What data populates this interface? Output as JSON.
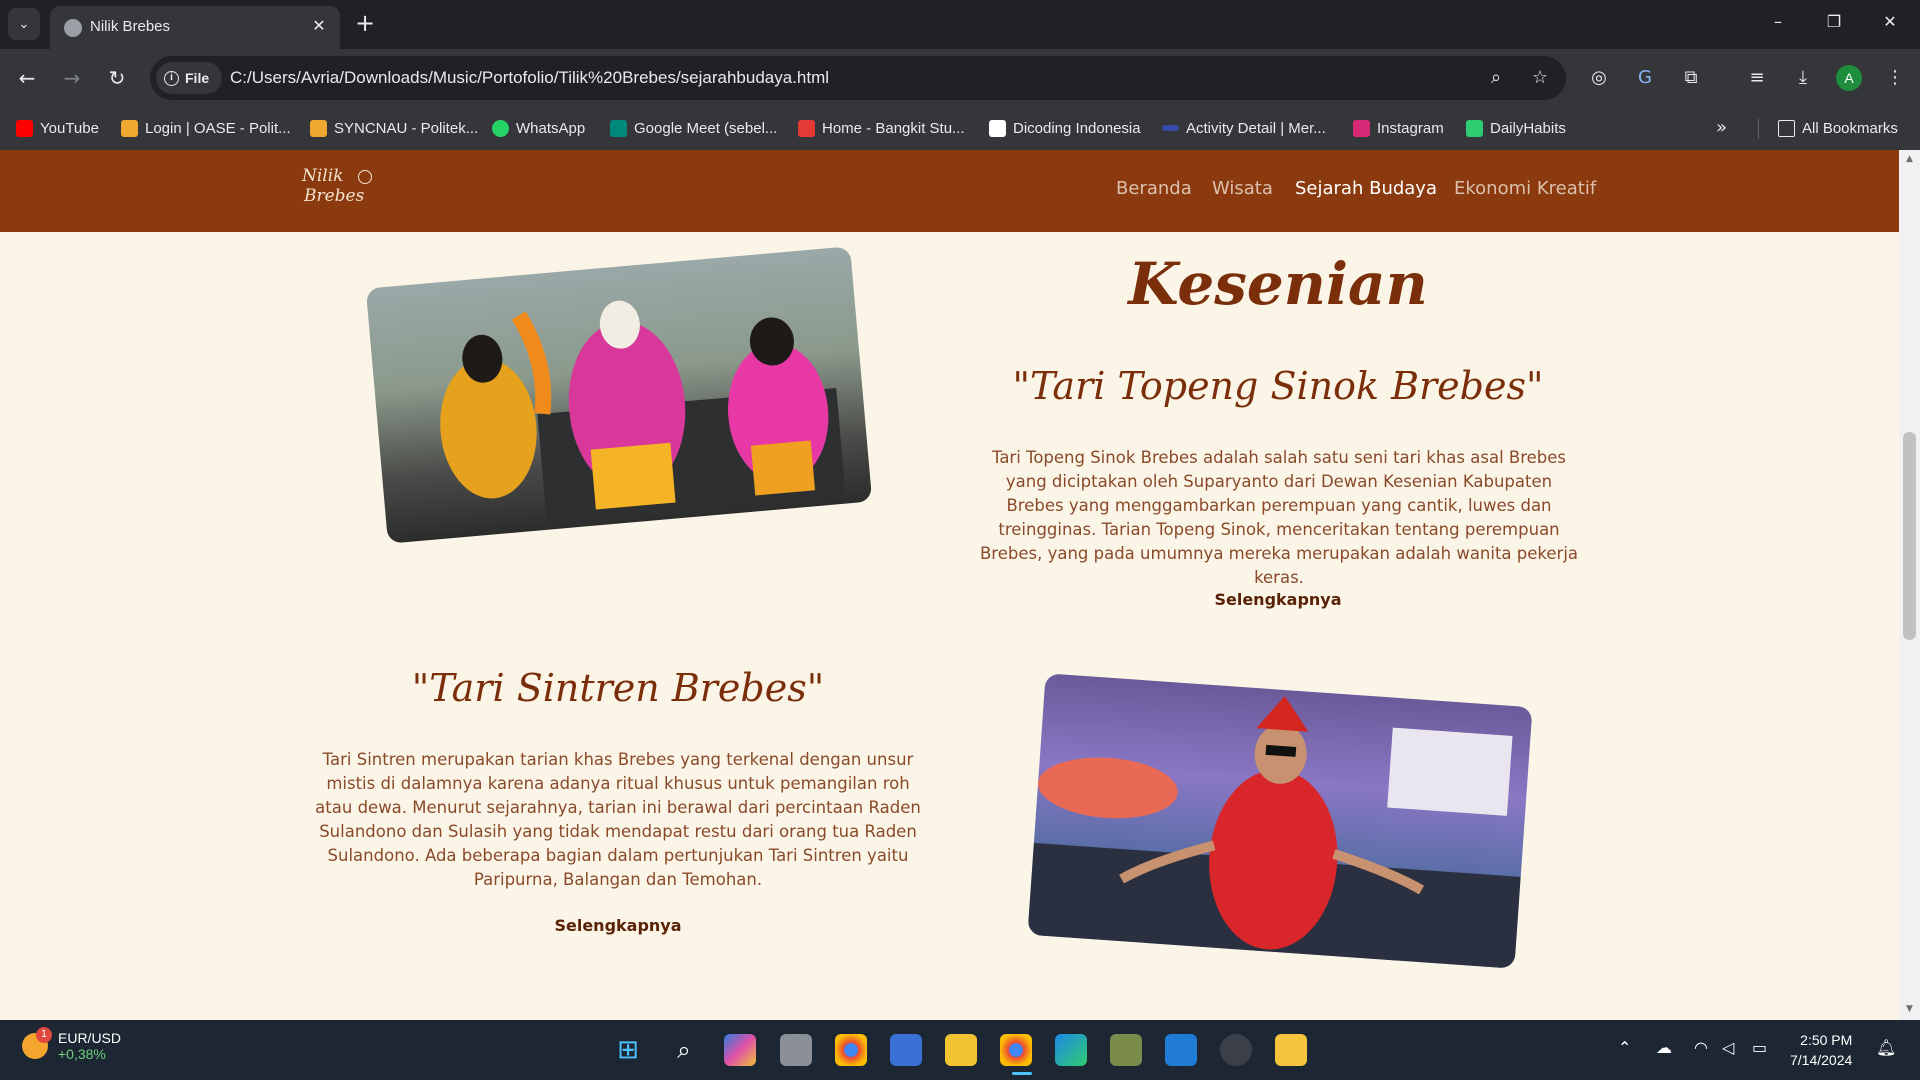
{
  "browser": {
    "tab_title": "Nilik Brebes",
    "new_tab_glyph": "+",
    "close_glyph": "✕",
    "file_chip": "File",
    "url": "C:/Users/Avria/Downloads/Music/Portofolio/Tilik%20Brebes/sejarahbudaya.html",
    "profile_initial": "A",
    "bookmarks": [
      {
        "label": "YouTube",
        "icon": "youtube-icon",
        "color": "#ff0000"
      },
      {
        "label": "Login | OASE - Polit...",
        "icon": "oase-icon",
        "color": "#f0a830"
      },
      {
        "label": "SYNCNAU - Politek...",
        "icon": "syncnau-icon",
        "color": "#f0a830"
      },
      {
        "label": "WhatsApp",
        "icon": "whatsapp-icon",
        "color": "#25d366"
      },
      {
        "label": "Google Meet (sebel...",
        "icon": "google-meet-icon",
        "color": "#00897b"
      },
      {
        "label": "Home - Bangkit Stu...",
        "icon": "bangkit-icon",
        "color": "#e53935"
      },
      {
        "label": "Dicoding Indonesia",
        "icon": "dicoding-icon",
        "color": "#ffffff"
      },
      {
        "label": "Activity Detail | Mer...",
        "icon": "merdeka-icon",
        "color": "#3949ab"
      },
      {
        "label": "Instagram",
        "icon": "instagram-icon",
        "color": "#d62976"
      },
      {
        "label": "DailyHabits",
        "icon": "dailyhabits-icon",
        "color": "#2ecc71"
      }
    ],
    "all_bookmarks": "All Bookmarks"
  },
  "site": {
    "logo_line1": "Nilik",
    "logo_line2": "Brebes",
    "nav": [
      "Beranda",
      "Wisata",
      "Sejarah Budaya",
      "Ekonomi Kreatif"
    ],
    "active_nav": "Sejarah Budaya",
    "section_title": "Kesenian",
    "items": [
      {
        "title": "\"Tari Topeng Sinok Brebes\"",
        "description": "Tari Topeng Sinok Brebes adalah salah satu seni tari khas asal Brebes yang diciptakan oleh Suparyanto dari Dewan Kesenian Kabupaten Brebes yang menggambarkan perempuan yang cantik, luwes dan treingginas. Tarian Topeng Sinok, menceritakan tentang perempuan Brebes, yang pada umumnya mereka merupakan adalah wanita pekerja keras.",
        "link": "Selengkapnya"
      },
      {
        "title": "\"Tari Sintren Brebes\"",
        "description": "Tari Sintren merupakan tarian khas Brebes yang terkenal dengan unsur mistis di dalamnya karena adanya ritual khusus untuk pemangilan roh atau dewa. Menurut sejarahnya, tarian ini berawal dari percintaan Raden Sulandono dan Sulasih yang tidak mendapat restu dari orang tua Raden Sulandono. Ada beberapa bagian dalam pertunjukan Tari Sintren yaitu Paripurna, Balangan dan Temohan.",
        "link": "Selengkapnya"
      }
    ],
    "colors": {
      "nav_bg": "#8a3a0e",
      "page_bg": "#fbf5e8",
      "heading": "#7a2e0a"
    }
  },
  "taskbar": {
    "widget_pair": "EUR/USD",
    "widget_change": "+0,38%",
    "widget_badge": "1",
    "time": "2:50 PM",
    "date": "7/14/2024"
  }
}
